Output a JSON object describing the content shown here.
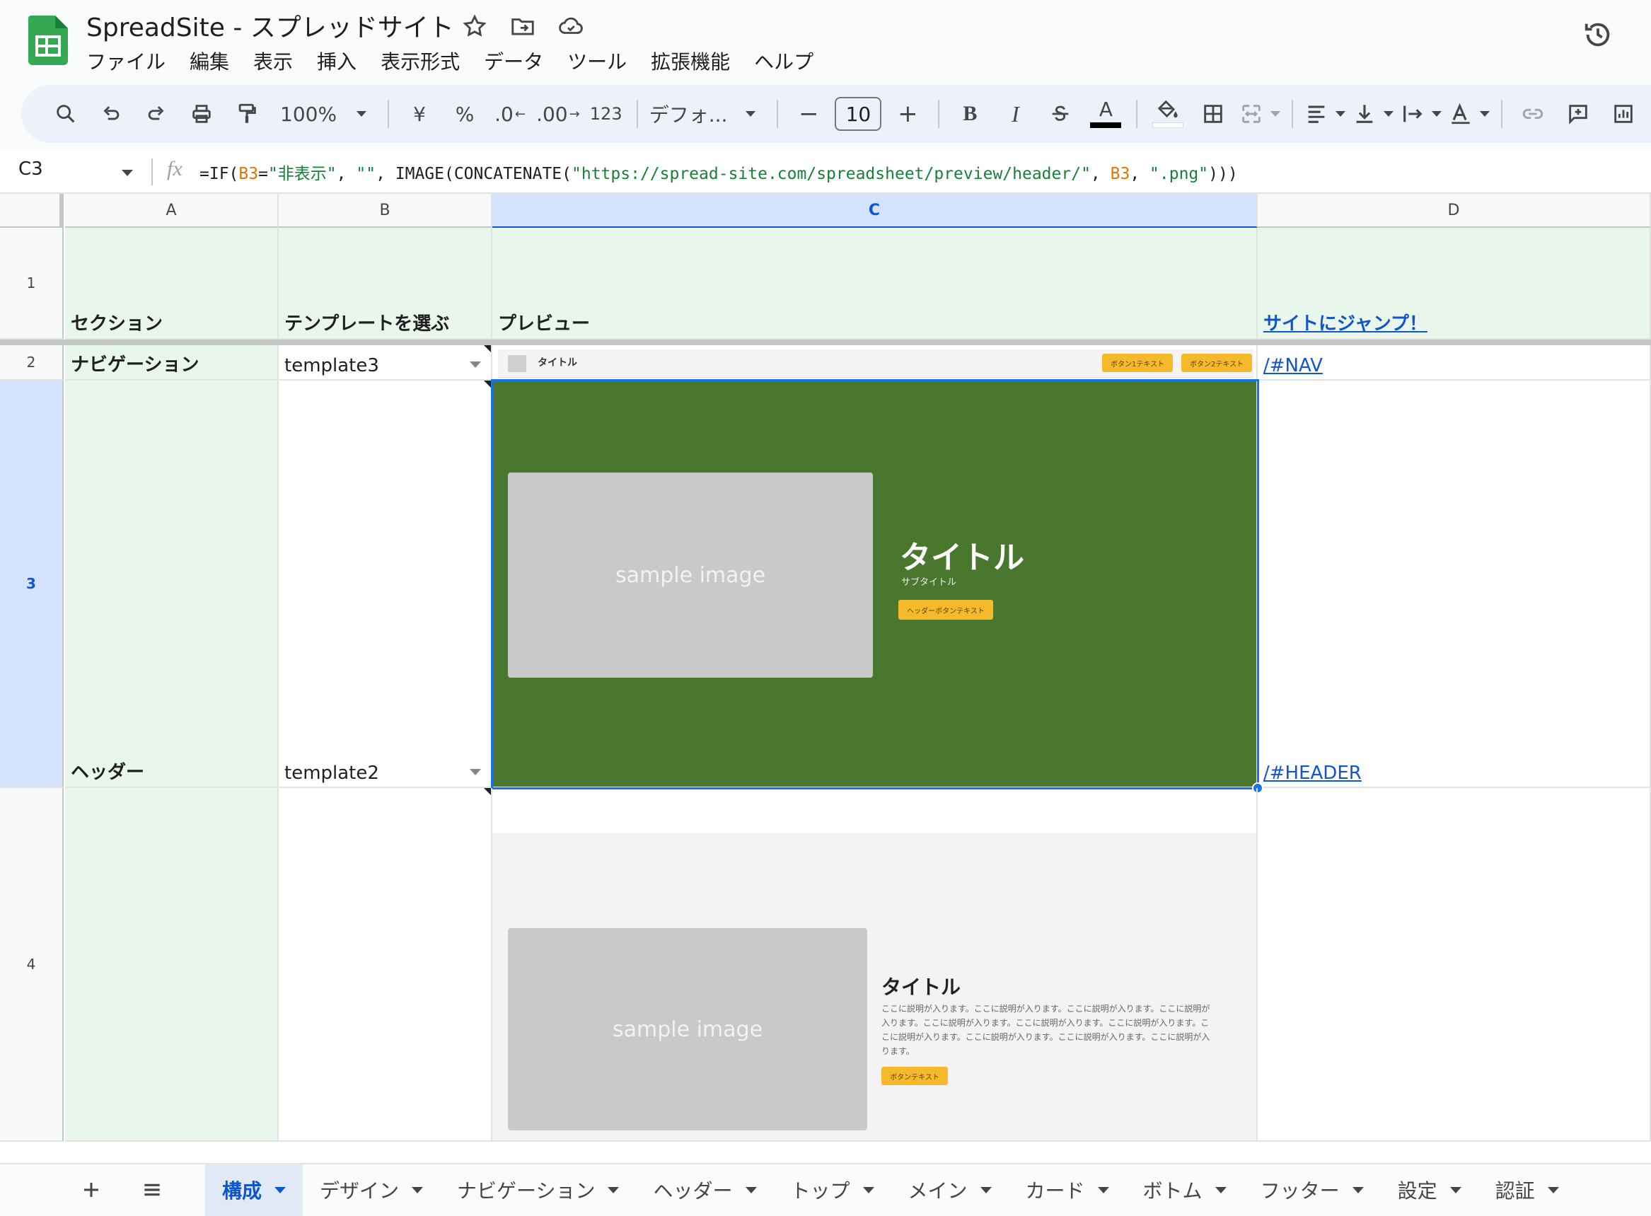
{
  "app": {
    "doc_title": "SpreadSite - スプレッドサイト",
    "menu": [
      "ファイル",
      "編集",
      "表示",
      "挿入",
      "表示形式",
      "データ",
      "ツール",
      "拡張機能",
      "ヘルプ"
    ]
  },
  "toolbar": {
    "zoom": "100%",
    "currency": "¥",
    "percent": "%",
    "decrease_decimal": ".0",
    "increase_decimal": ".00",
    "number_format": "123",
    "font": "デフォ...",
    "font_size": "10",
    "bold": "B",
    "italic": "I",
    "text_color_glyph": "A"
  },
  "formula_bar": {
    "cell_ref": "C3",
    "fx": "fx",
    "formula_parts": {
      "p1": "=IF(",
      "p2": "B3",
      "p3": "=",
      "p4": "\"非表示\"",
      "p5": ", ",
      "p6": "\"\"",
      "p7": ", IMAGE(CONCATENATE(",
      "p8": "\"https://spread-site.com/spreadsheet/preview/header/\"",
      "p9": ", ",
      "p10": "B3",
      "p11": ", ",
      "p12": "\".png\"",
      "p13": ")))"
    }
  },
  "grid": {
    "columns": [
      "A",
      "B",
      "C",
      "D"
    ],
    "rows": [
      "1",
      "2",
      "3",
      "4"
    ],
    "header_row": {
      "a": "セクション",
      "b": "テンプレートを選ぶ",
      "c": "プレビュー",
      "d": "サイトにジャンプ！"
    },
    "row2": {
      "a": "ナビゲーション",
      "b": "template3",
      "d": "/#NAV"
    },
    "row3": {
      "a": "ヘッダー",
      "b": "template2",
      "d": "/#HEADER"
    },
    "nav_preview": {
      "title": "タイトル",
      "btn1": "ボタン1テキスト",
      "btn2": "ボタン2テキスト"
    },
    "header_preview": {
      "image_text": "sample image",
      "title": "タイトル",
      "subtitle": "サブタイトル",
      "button": "ヘッダーボタンテキスト",
      "bg_color": "#4a772e"
    },
    "top_preview": {
      "image_text": "sample image",
      "title": "タイトル",
      "desc_lines": [
        "ここに説明が入ります。ここに説明が入ります。ここに説明が入ります。ここに説明が",
        "入ります。ここに説明が入ります。ここに説明が入ります。ここに説明が入ります。こ",
        "こに説明が入ります。ここに説明が入ります。ここに説明が入ります。ここに説明が入",
        "ります。"
      ],
      "button": "ボタンテキスト"
    }
  },
  "sheets": {
    "tabs": [
      "構成",
      "デザイン",
      "ナビゲーション",
      "ヘッダー",
      "トップ",
      "メイン",
      "カード",
      "ボトム",
      "フッター",
      "設定",
      "認証"
    ],
    "active": "構成"
  },
  "colors": {
    "accent": "#0b57d0",
    "header_fill": "#e9f6ec",
    "selection": "#1a73e8",
    "button_yellow": "#f6b92b"
  }
}
